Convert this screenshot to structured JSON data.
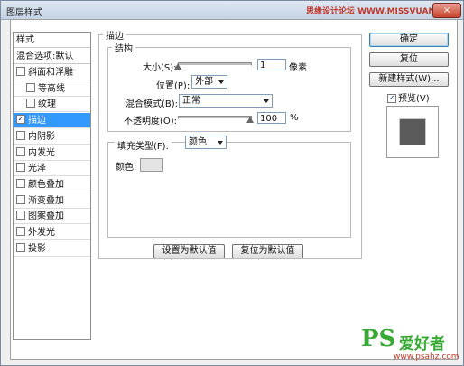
{
  "window": {
    "title": "图层样式",
    "watermark": "思缘设计论坛 WWW.MISSVUAN.COM",
    "close": "×"
  },
  "left_panel": {
    "header": "样式",
    "blend": "混合选项:默认",
    "items": [
      {
        "label": "斜面和浮雕",
        "checked": false,
        "indent": false
      },
      {
        "label": "等高线",
        "checked": false,
        "indent": true
      },
      {
        "label": "纹理",
        "checked": false,
        "indent": true
      },
      {
        "label": "描边",
        "checked": true,
        "indent": false,
        "selected": true
      },
      {
        "label": "内阴影",
        "checked": false,
        "indent": false
      },
      {
        "label": "内发光",
        "checked": false,
        "indent": false
      },
      {
        "label": "光泽",
        "checked": false,
        "indent": false
      },
      {
        "label": "颜色叠加",
        "checked": false,
        "indent": false
      },
      {
        "label": "渐变叠加",
        "checked": false,
        "indent": false
      },
      {
        "label": "图案叠加",
        "checked": false,
        "indent": false
      },
      {
        "label": "外发光",
        "checked": false,
        "indent": false
      },
      {
        "label": "投影",
        "checked": false,
        "indent": false
      }
    ]
  },
  "stroke": {
    "title": "描边",
    "structure_title": "结构",
    "size_label": "大小(S):",
    "size_value": "1",
    "size_unit": "像素",
    "position_label": "位置(P):",
    "position_value": "外部",
    "blend_label": "混合模式(B):",
    "blend_value": "正常",
    "opacity_label": "不透明度(O):",
    "opacity_value": "100",
    "opacity_unit": "%",
    "fill_type_label": "填充类型(F):",
    "fill_type_value": "颜色",
    "color_label": "颜色:",
    "color_value": "#e4e4e4",
    "size_level": 0.0,
    "opacity_level": 1.0
  },
  "buttons": {
    "set_default": "设置为默认值",
    "reset_default": "复位为默认值",
    "ok": "确定",
    "reset": "复位",
    "new_style": "新建样式(W)...",
    "preview": "预览(V)"
  },
  "logo": {
    "ps": "PS",
    "name": "爱好者",
    "url": "www.psahz.com"
  }
}
